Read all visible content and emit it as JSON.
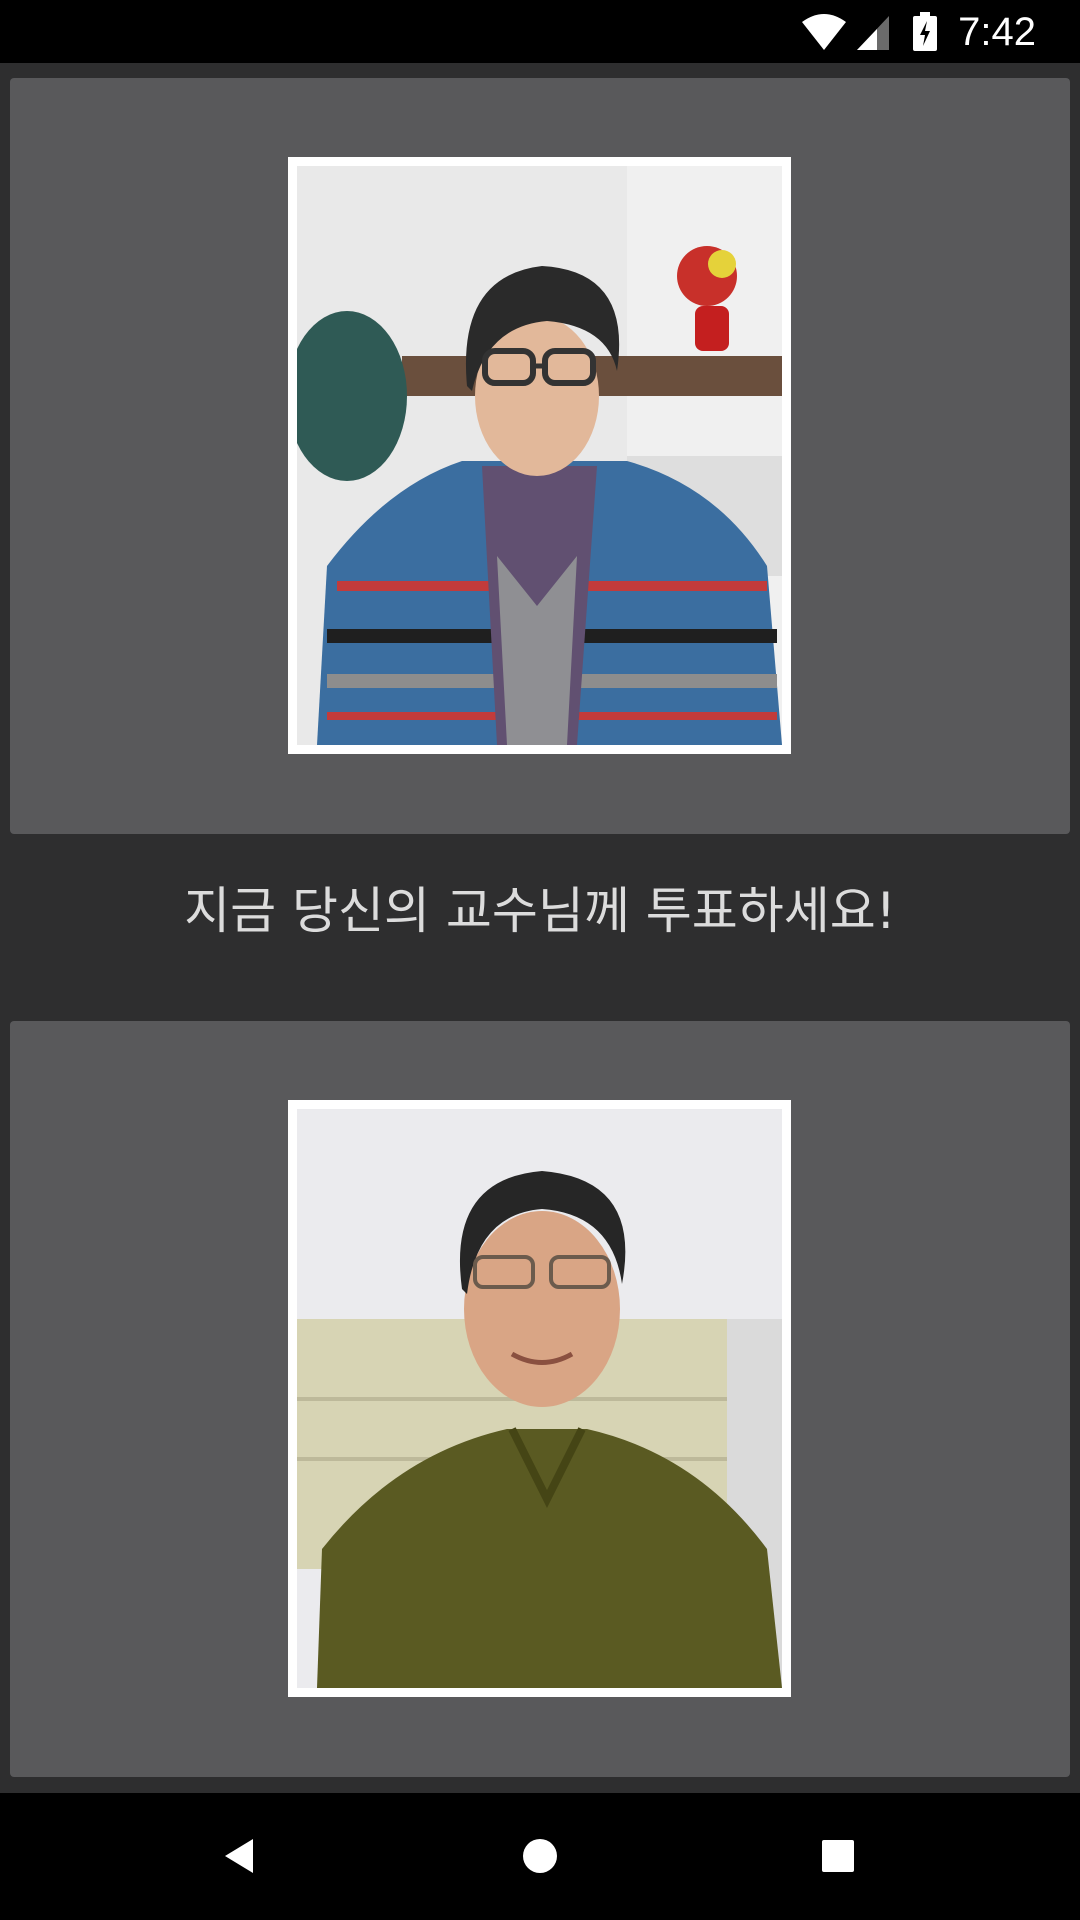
{
  "status_bar": {
    "time": "7:42",
    "icons": [
      "wifi-icon",
      "cell-signal-icon",
      "battery-charging-icon"
    ]
  },
  "main": {
    "prompt": "지금 당신의 교수님께 투표하세요!",
    "candidates": [
      {
        "photo": "professor-photo-glasses-striped-jacket"
      },
      {
        "photo": "professor-photo-olive-polo"
      }
    ]
  },
  "nav_bar": {
    "buttons": [
      "back-icon",
      "home-icon",
      "recent-apps-icon"
    ]
  },
  "colors": {
    "background": "#2e2e2f",
    "card": "#59595b",
    "text": "#dcdcdc",
    "bars": "#000000"
  }
}
